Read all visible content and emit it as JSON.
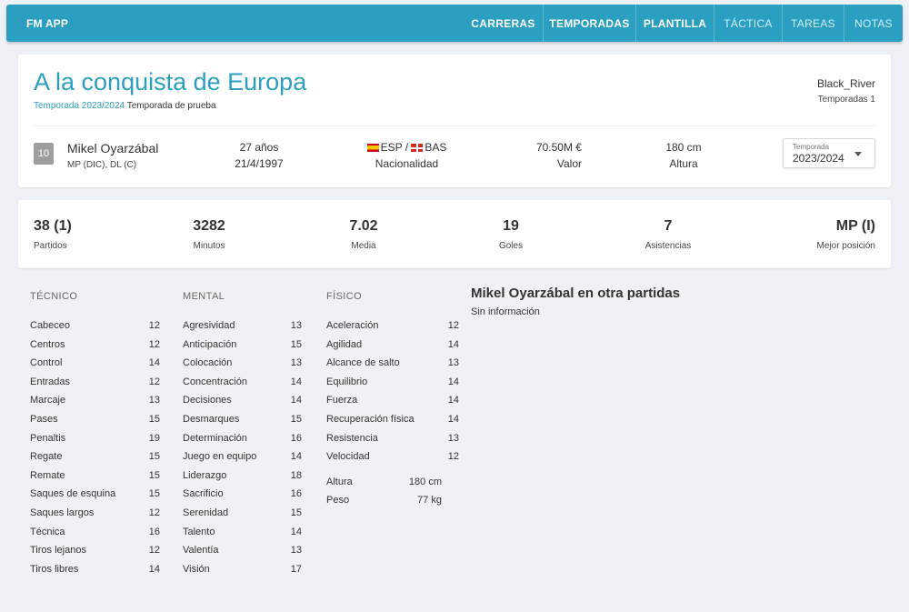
{
  "nav": {
    "brand": "FM APP",
    "items": [
      {
        "label": "CARRERAS"
      },
      {
        "label": "TEMPORADAS"
      },
      {
        "label": "PLANTILLA"
      },
      {
        "label": "TÁCTICA"
      },
      {
        "label": "TAREAS"
      },
      {
        "label": "NOTAS"
      }
    ]
  },
  "career": {
    "title": "A la conquista de Europa",
    "season_link": "Temporada 2023/2024",
    "season_desc": "Temporada de prueba",
    "user": "Black_River",
    "user_seasons": "Temporadas 1"
  },
  "player": {
    "number": "10",
    "name": "Mikel Oyarzábal",
    "positions": "MP (DIC), DL (C)",
    "age": "27 años",
    "birthdate": "21/4/1997",
    "nationality": "ESP / ",
    "nationality2": "BAS",
    "nationality_label": "Nacionalidad",
    "value": "70.50M €",
    "value_label": "Valor",
    "height": "180 cm",
    "height_label": "Altura"
  },
  "season_select": {
    "label": "Temporada",
    "value": "2023/2024"
  },
  "stats": [
    {
      "value": "38 (1)",
      "label": "Partidos"
    },
    {
      "value": "3282",
      "label": "Minutos"
    },
    {
      "value": "7.02",
      "label": "Media"
    },
    {
      "value": "19",
      "label": "Goles"
    },
    {
      "value": "7",
      "label": "Asistencias"
    },
    {
      "value": "MP (I)",
      "label": "Mejor posición"
    }
  ],
  "attributes": {
    "tecnico": {
      "title": "TÉCNICO",
      "items": [
        {
          "name": "Cabeceo",
          "value": "12"
        },
        {
          "name": "Centros",
          "value": "12"
        },
        {
          "name": "Control",
          "value": "14"
        },
        {
          "name": "Entradas",
          "value": "12"
        },
        {
          "name": "Marcaje",
          "value": "13"
        },
        {
          "name": "Pases",
          "value": "15"
        },
        {
          "name": "Penaltis",
          "value": "19"
        },
        {
          "name": "Regate",
          "value": "15"
        },
        {
          "name": "Remate",
          "value": "15"
        },
        {
          "name": "Saques de esquina",
          "value": "15"
        },
        {
          "name": "Saques largos",
          "value": "12"
        },
        {
          "name": "Técnica",
          "value": "16"
        },
        {
          "name": "Tiros lejanos",
          "value": "12"
        },
        {
          "name": "Tiros libres",
          "value": "14"
        }
      ]
    },
    "mental": {
      "title": "MENTAL",
      "items": [
        {
          "name": "Agresividad",
          "value": "13"
        },
        {
          "name": "Anticipación",
          "value": "15"
        },
        {
          "name": "Colocación",
          "value": "13"
        },
        {
          "name": "Concentración",
          "value": "14"
        },
        {
          "name": "Decisiones",
          "value": "14"
        },
        {
          "name": "Desmarques",
          "value": "15"
        },
        {
          "name": "Determinación",
          "value": "16"
        },
        {
          "name": "Juego en equipo",
          "value": "14"
        },
        {
          "name": "Liderazgo",
          "value": "18"
        },
        {
          "name": "Sacrificio",
          "value": "16"
        },
        {
          "name": "Serenidad",
          "value": "15"
        },
        {
          "name": "Talento",
          "value": "14"
        },
        {
          "name": "Valentía",
          "value": "13"
        },
        {
          "name": "Visión",
          "value": "17"
        }
      ]
    },
    "fisico": {
      "title": "FÍSICO",
      "items": [
        {
          "name": "Aceleración",
          "value": "12"
        },
        {
          "name": "Agilidad",
          "value": "14"
        },
        {
          "name": "Alcance de salto",
          "value": "13"
        },
        {
          "name": "Equilibrio",
          "value": "14"
        },
        {
          "name": "Fuerza",
          "value": "14"
        },
        {
          "name": "Recuperación física",
          "value": "14"
        },
        {
          "name": "Resistencia",
          "value": "13"
        },
        {
          "name": "Velocidad",
          "value": "12"
        }
      ],
      "extra": [
        {
          "name": "Altura",
          "value": "180 cm"
        },
        {
          "name": "Peso",
          "value": "77 kg"
        }
      ]
    }
  },
  "other": {
    "title": "Mikel Oyarzábal en otra partidas",
    "text": "Sin información"
  }
}
